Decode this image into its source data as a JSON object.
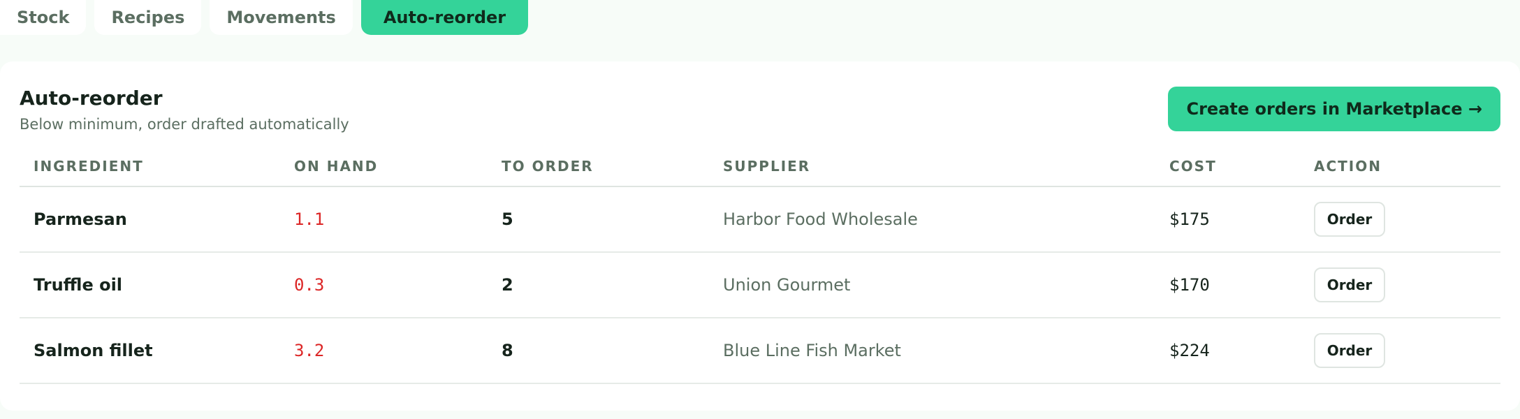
{
  "tabs": [
    {
      "label": "Stock",
      "active": false
    },
    {
      "label": "Recipes",
      "active": false
    },
    {
      "label": "Movements",
      "active": false
    },
    {
      "label": "Auto-reorder",
      "active": true
    }
  ],
  "panel": {
    "title": "Auto-reorder",
    "subtitle": "Below minimum, order drafted automatically",
    "primary_button_label": "Create orders in Marketplace →"
  },
  "table": {
    "columns": [
      "INGREDIENT",
      "ON HAND",
      "TO ORDER",
      "SUPPLIER",
      "COST",
      "ACTION"
    ],
    "rows": [
      {
        "ingredient": "Parmesan",
        "on_hand": "1.1",
        "to_order": "5",
        "supplier": "Harbor Food Wholesale",
        "cost": "$175",
        "action": "Order"
      },
      {
        "ingredient": "Truffle oil",
        "on_hand": "0.3",
        "to_order": "2",
        "supplier": "Union Gourmet",
        "cost": "$170",
        "action": "Order"
      },
      {
        "ingredient": "Salmon fillet",
        "on_hand": "3.2",
        "to_order": "8",
        "supplier": "Blue Line Fish Market",
        "cost": "$224",
        "action": "Order"
      }
    ]
  },
  "colors": {
    "accent": "#34d399",
    "danger": "#dc2626",
    "muted_text": "#5b6e61"
  }
}
